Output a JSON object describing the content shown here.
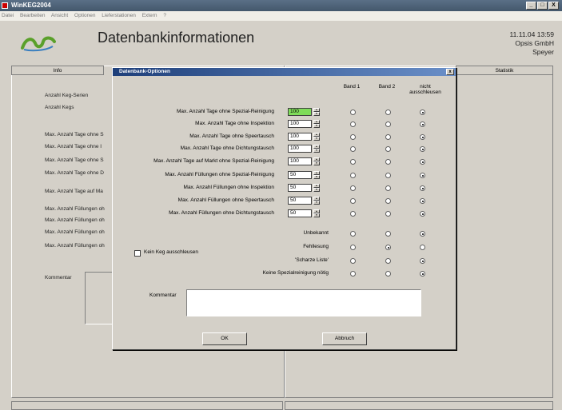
{
  "window": {
    "title": "WinKEG2004",
    "minimize": "_",
    "maximize": "□",
    "close": "X"
  },
  "menu": [
    "Datei",
    "Bearbeiten",
    "Ansicht",
    "Optionen",
    "Lieferstationen",
    "Extern",
    "?"
  ],
  "header": {
    "app_title": "Datenbankinformationen",
    "datetime": "11.11.04 13:59",
    "company": "Opsis GmbH",
    "city": "Speyer"
  },
  "panels": {
    "info_tab": "Info",
    "statistik_tab": "Statistik"
  },
  "background_labels": [
    "Anzahl Keg-Serien",
    "Anzahl Kegs",
    "Max. Anzahl Tage ohne S",
    "Max. Anzahl Tage ohne I",
    "Max. Anzahl Tage ohne S",
    "Max. Anzahl Tage ohne D",
    "Max. Anzahl Tage auf Ma",
    "Max. Anzahl Füllungen oh",
    "Max. Anzahl Füllungen oh",
    "Max. Anzahl Füllungen oh",
    "Max. Anzahl Füllungen oh",
    "Kommentar"
  ],
  "dialog": {
    "title": "Datenbank-Optionen",
    "col_band1": "Band 1",
    "col_band2": "Band 2",
    "col_nicht": "nicht ausschleusen",
    "rows": [
      {
        "label": "Max. Anzahl Tage ohne Spezial-Reinigung",
        "value": "100",
        "sel": 3
      },
      {
        "label": "Max. Anzahl Tage ohne Inspektion",
        "value": "100",
        "sel": 3
      },
      {
        "label": "Max. Anzahl Tage ohne Speertausch",
        "value": "100",
        "sel": 3
      },
      {
        "label": "Max. Anzahl Tage ohne Dichtungstausch",
        "value": "100",
        "sel": 3
      },
      {
        "label": "Max. Anzahl Tage auf Markt ohne Spezial-Reinigung",
        "value": "100",
        "sel": 3
      },
      {
        "label": "Max. Anzahl Füllungen ohne Spezial-Reinigung",
        "value": "50",
        "sel": 3
      },
      {
        "label": "Max. Anzahl Füllungen ohne Inspektion",
        "value": "50",
        "sel": 3
      },
      {
        "label": "Max. Anzahl Füllungen ohne Speertausch",
        "value": "50",
        "sel": 3
      },
      {
        "label": "Max. Anzahl Füllungen ohne Dichtungstausch",
        "value": "50",
        "sel": 3
      }
    ],
    "status_rows": [
      {
        "label": "Unbekannt",
        "sel": 3
      },
      {
        "label": "Fehllesung",
        "sel": 2
      },
      {
        "label": "'Scharze Liste'",
        "sel": 3
      },
      {
        "label": "Keine Spezialreinigung nötig",
        "sel": 3
      }
    ],
    "kein_keg_label": "Kein Keg ausschleusen",
    "kommentar_label": "Kommentar",
    "kommentar_value": "",
    "ok": "OK",
    "abbruch": "Abbruch"
  },
  "colors": {
    "title_gradient_start": "#1e3f7a",
    "highlight": "#7fdc5a"
  }
}
